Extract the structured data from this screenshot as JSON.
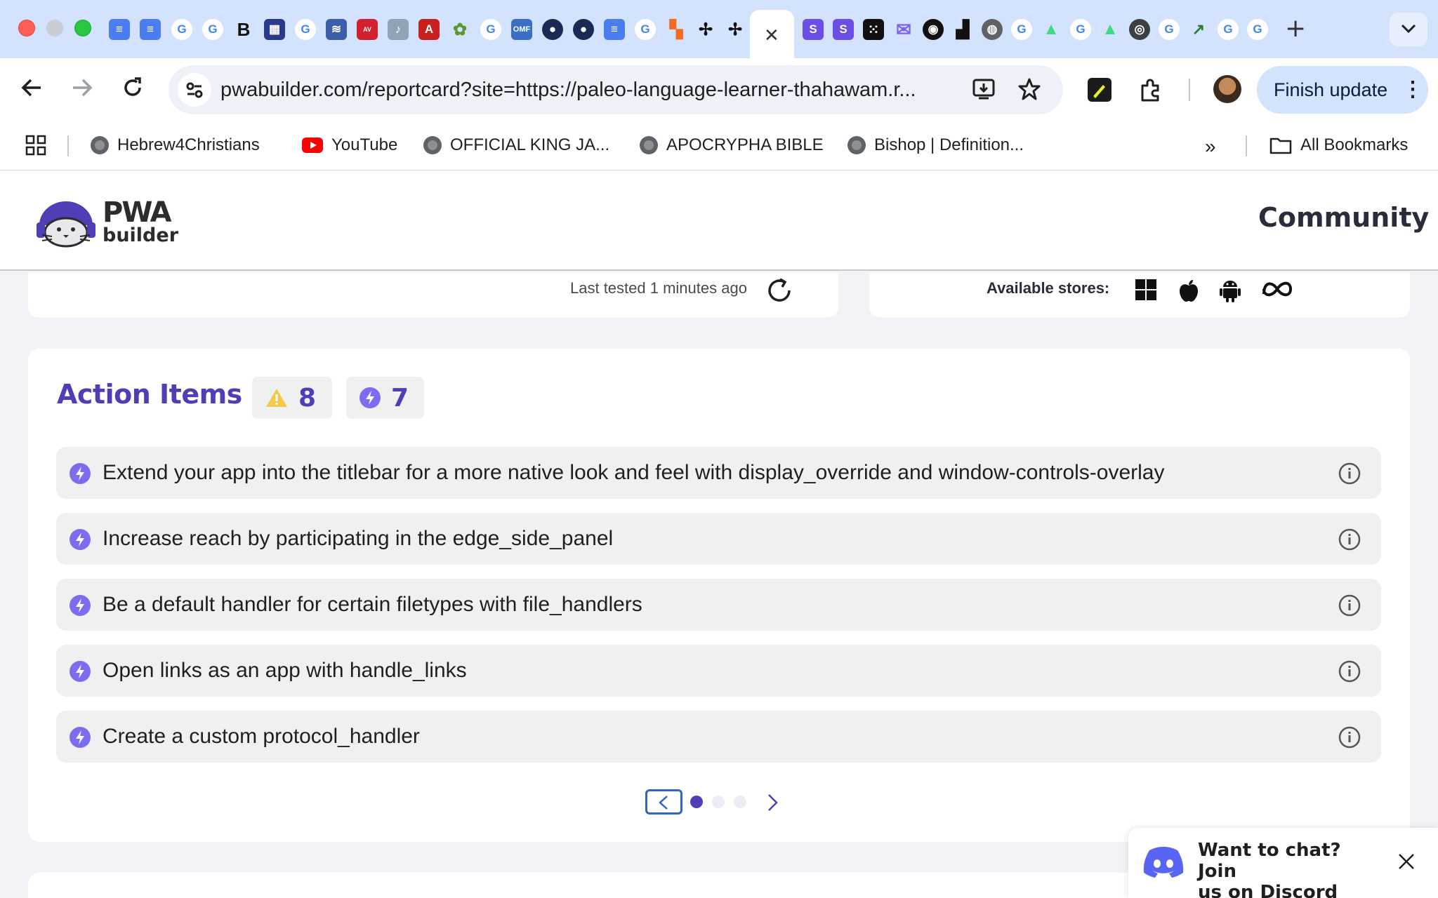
{
  "browser": {
    "address": "pwabuilder.com/reportcard?site=https://paleo-language-learner-thahawam.r...",
    "finish_update": "Finish update",
    "bookmarks": [
      {
        "label": "Hebrew4Christians",
        "icon": "globe-icon"
      },
      {
        "label": "YouTube",
        "icon": "youtube-icon"
      },
      {
        "label": "OFFICIAL KING JA...",
        "icon": "globe-icon"
      },
      {
        "label": "APOCRYPHA BIBLE",
        "icon": "globe-icon"
      },
      {
        "label": "Bishop | Definition...",
        "icon": "globe-icon"
      }
    ],
    "all_bookmarks": "All Bookmarks",
    "more_bookmarks": "»"
  },
  "site": {
    "logo_line1": "PWA",
    "logo_line2": "builder",
    "nav_community": "Community"
  },
  "status": {
    "last_tested": "Last tested 1 minutes ago",
    "available_stores_label": "Available stores:",
    "stores": [
      "windows-icon",
      "apple-icon",
      "android-icon",
      "meta-icon"
    ]
  },
  "action_items": {
    "title": "Action Items",
    "warning_count": "8",
    "feature_count": "7",
    "items": [
      {
        "text": "Extend your app into the titlebar for a more native look and feel with display_override and window-controls-overlay"
      },
      {
        "text": "Increase reach by participating in the edge_side_panel"
      },
      {
        "text": "Be a default handler for certain filetypes with file_handlers"
      },
      {
        "text": "Open links as an app with handle_links"
      },
      {
        "text": "Create a custom protocol_handler"
      }
    ],
    "pager": {
      "current": 1,
      "total": 3
    }
  },
  "discord": {
    "line1": "Want to chat? Join",
    "line2_prefix": "us on ",
    "line2_link": "Discord"
  },
  "colors": {
    "accent": "#4f3fb6",
    "bolt": "#7b6cf0",
    "warning": "#f2c94c",
    "chrome_blue": "#d3e3fd",
    "discord": "#5865f2"
  }
}
